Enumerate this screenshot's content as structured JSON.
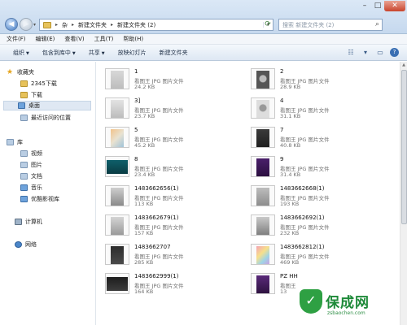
{
  "address": {
    "crumbs": [
      "杂",
      "新建文件夹",
      "新建文件夹 (2)"
    ]
  },
  "search": {
    "placeholder": "搜索 新建文件夹 (2)"
  },
  "menu": [
    "文件(F)",
    "编辑(E)",
    "查看(V)",
    "工具(T)",
    "帮助(H)"
  ],
  "toolbar": {
    "organize": "组织",
    "include": "包含到库中",
    "share": "共享",
    "slideshow": "放映幻灯片",
    "new_folder": "新建文件夹"
  },
  "nav": {
    "favorites": "收藏夹",
    "fav_items": [
      "2345下载",
      "下载",
      "桌面",
      "最近访问的位置"
    ],
    "libraries": "库",
    "lib_items": [
      "视频",
      "图片",
      "文档",
      "音乐",
      "优酷影视库"
    ],
    "computer": "计算机",
    "network": "网络"
  },
  "files": [
    {
      "name": "1",
      "type": "看图王 JPG 图片文件",
      "size": "24.2 KB"
    },
    {
      "name": "2",
      "type": "看图王 JPG 图片文件",
      "size": "28.9 KB"
    },
    {
      "name": "3]",
      "type": "看图王 JPG 图片文件",
      "size": "23.7 KB"
    },
    {
      "name": "4",
      "type": "看图王 JPG 图片文件",
      "size": "31.1 KB"
    },
    {
      "name": "5",
      "type": "看图王 JPG 图片文件",
      "size": "45.2 KB"
    },
    {
      "name": "7",
      "type": "看图王 JPG 图片文件",
      "size": "40.8 KB"
    },
    {
      "name": "8",
      "type": "看图王 JPG 图片文件",
      "size": "23.4 KB"
    },
    {
      "name": "9",
      "type": "看图王 JPG 图片文件",
      "size": "31.4 KB"
    },
    {
      "name": "1483662656(1)",
      "type": "看图王 JPG 图片文件",
      "size": "113 KB"
    },
    {
      "name": "1483662668(1)",
      "type": "看图王 JPG 图片文件",
      "size": "193 KB"
    },
    {
      "name": "1483662679(1)",
      "type": "看图王 JPG 图片文件",
      "size": "157 KB"
    },
    {
      "name": "1483662692(1)",
      "type": "看图王 JPG 图片文件",
      "size": "232 KB"
    },
    {
      "name": "1483662707",
      "type": "看图王 JPG 图片文件",
      "size": "285 KB"
    },
    {
      "name": "1483662812(1)",
      "type": "看图王 JPG 图片文件",
      "size": "469 KB"
    },
    {
      "name": "1483662999(1)",
      "type": "看图王 JPG 图片文件",
      "size": "164 KB"
    },
    {
      "name": "PZ HH",
      "type": "看图王",
      "size": "13"
    }
  ],
  "watermark": {
    "title": "保成网",
    "url": "zsbaochen.com"
  }
}
